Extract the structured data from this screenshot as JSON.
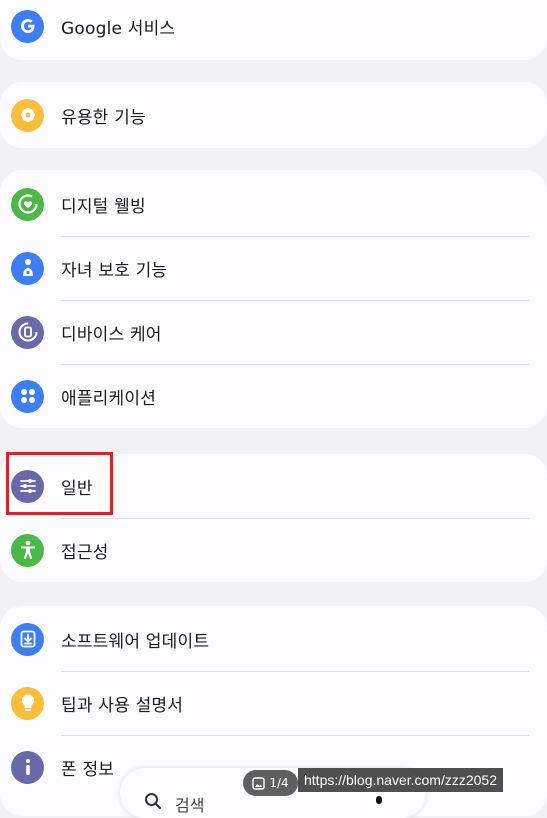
{
  "colors": {
    "background": "#f2f2f4",
    "card": "#fcfcfe",
    "google": "#3f7df2",
    "useful": "#fbbe3c",
    "wellbeing": "#4bb847",
    "kids": "#3f7df2",
    "device_care": "#6869a6",
    "apps": "#3f7df2",
    "general": "#6869a6",
    "accessibility": "#4bb847",
    "update": "#3f7df2",
    "tips": "#fbbe3c",
    "about": "#6869a6",
    "highlight": "#d8242a"
  },
  "settings": {
    "google": {
      "label": "Google 서비스",
      "icon": "google-g-icon"
    },
    "useful": {
      "label": "유용한 기능",
      "icon": "gear-flower-icon"
    },
    "wellbeing": {
      "label": "디지털 웰빙",
      "icon": "heart-ring-icon"
    },
    "kids": {
      "label": "자녀 보호 기능",
      "icon": "child-icon"
    },
    "device_care": {
      "label": "디바이스 케어",
      "icon": "device-care-icon"
    },
    "apps": {
      "label": "애플리케이션",
      "icon": "apps-grid-icon"
    },
    "general": {
      "label": "일반",
      "icon": "sliders-icon"
    },
    "accessibility": {
      "label": "접근성",
      "icon": "person-icon"
    },
    "update": {
      "label": "소프트웨어 업데이트",
      "icon": "download-icon"
    },
    "tips": {
      "label": "팁과 사용 설명서",
      "icon": "lightbulb-icon"
    },
    "about": {
      "label": "폰 정보",
      "icon": "info-icon"
    }
  },
  "search": {
    "label": "검색"
  },
  "page_indicator": "1/4",
  "watermark": "https://blog.naver.com/zzz2052"
}
